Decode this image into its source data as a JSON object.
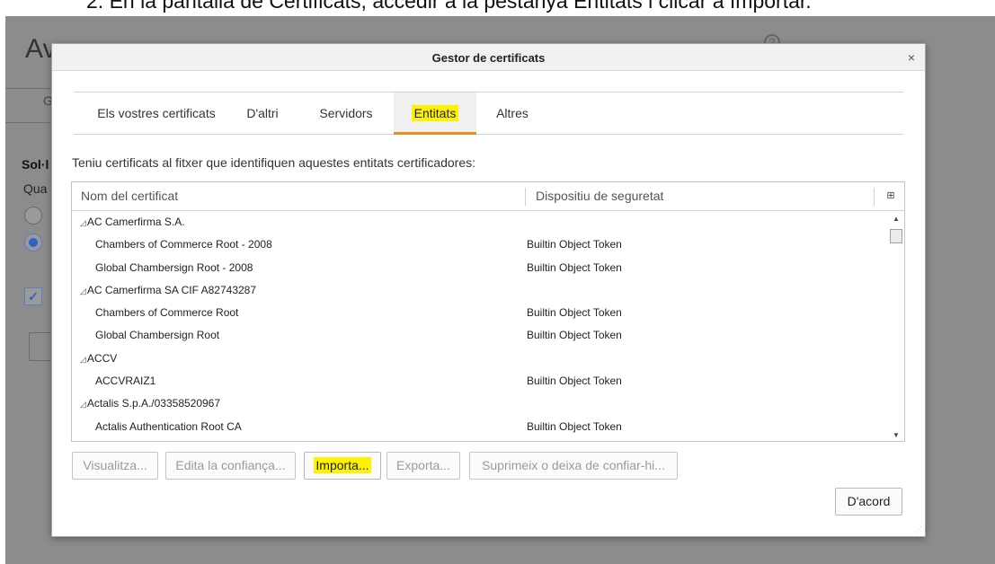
{
  "caption": "2.  En la pantalla de Certificats, accedir a la pestanya Entitats i clicar a Importar.",
  "background": {
    "title": "Av",
    "tab_label": "G",
    "section_label": "Sol·l",
    "question_label": "Qua",
    "help_icon": "?"
  },
  "dialog": {
    "title": "Gestor de certificats",
    "close_symbol": "×",
    "tabs": [
      {
        "label": "Els vostres certificats",
        "active": false
      },
      {
        "label": "D'altri",
        "active": false
      },
      {
        "label": "Servidors",
        "active": false
      },
      {
        "label": "Entitats",
        "active": true
      },
      {
        "label": "Altres",
        "active": false
      }
    ],
    "intro": "Teniu certificats al fitxer que identifiquen aquestes entitats certificadores:",
    "columns": {
      "name": "Nom del certificat",
      "device": "Dispositiu de seguretat",
      "picker_icon": "column-picker-icon"
    },
    "rows": [
      {
        "name": "AC Camerfirma S.A.",
        "device": "",
        "group": true
      },
      {
        "name": "Chambers of Commerce Root - 2008",
        "device": "Builtin Object Token",
        "group": false
      },
      {
        "name": "Global Chambersign Root - 2008",
        "device": "Builtin Object Token",
        "group": false
      },
      {
        "name": "AC Camerfirma SA CIF A82743287",
        "device": "",
        "group": true
      },
      {
        "name": "Chambers of Commerce Root",
        "device": "Builtin Object Token",
        "group": false
      },
      {
        "name": "Global Chambersign Root",
        "device": "Builtin Object Token",
        "group": false
      },
      {
        "name": "ACCV",
        "device": "",
        "group": true
      },
      {
        "name": "ACCVRAIZ1",
        "device": "Builtin Object Token",
        "group": false
      },
      {
        "name": "Actalis S.p.A./03358520967",
        "device": "",
        "group": true
      },
      {
        "name": "Actalis Authentication Root CA",
        "device": "Builtin Object Token",
        "group": false
      }
    ],
    "buttons": {
      "view": "Visualitza...",
      "edit_trust": "Edita la confiança...",
      "import": "Importa...",
      "export": "Exporta...",
      "delete": "Suprimeix o deixa de confiar-hi...",
      "ok": "D'acord"
    },
    "highlight_color": "#fff200",
    "accent_color": "#f18a1c"
  }
}
